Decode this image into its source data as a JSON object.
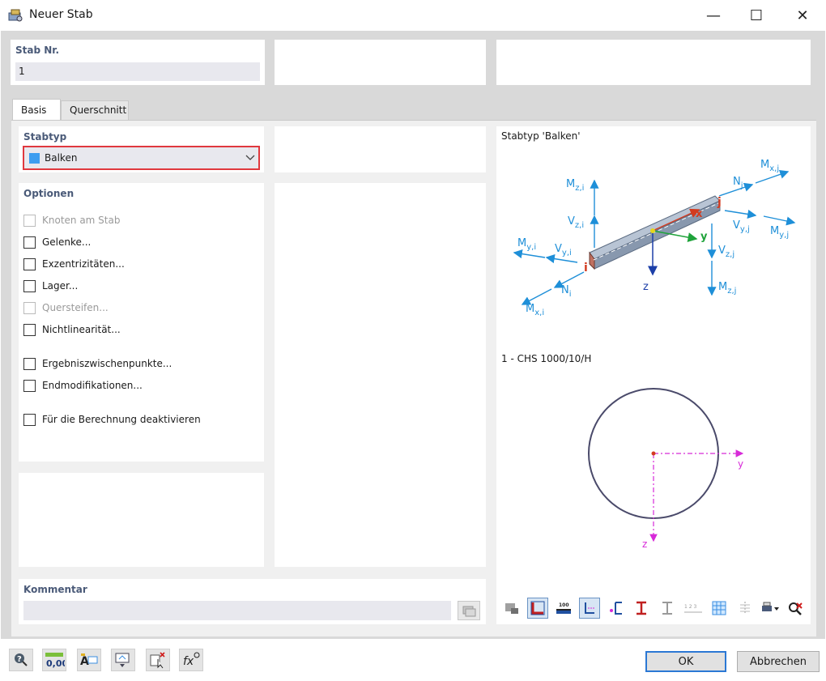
{
  "window": {
    "title": "Neuer Stab",
    "min_glyph": "—",
    "max_glyph": "☐",
    "close_glyph": "✕"
  },
  "stab": {
    "label": "Stab Nr.",
    "value": "1"
  },
  "tabs": [
    {
      "label": "Basis"
    },
    {
      "label": "Querschnitt"
    }
  ],
  "stabtyp": {
    "label": "Stabtyp",
    "value": "Balken",
    "color": "#3d9df0"
  },
  "optionen": {
    "label": "Optionen",
    "items": [
      {
        "label": "Knoten am Stab",
        "enabled": false
      },
      {
        "label": "Gelenke...",
        "enabled": true
      },
      {
        "label": "Exzentrizitäten...",
        "enabled": true
      },
      {
        "label": "Lager...",
        "enabled": true
      },
      {
        "label": "Quersteifen...",
        "enabled": false
      },
      {
        "label": "Nichtlinearität...",
        "enabled": true
      },
      {
        "label": "Ergebniszwischenpunkte...",
        "enabled": true
      },
      {
        "label": "Endmodifikationen...",
        "enabled": true
      },
      {
        "label": "Für die Berechnung deaktivieren",
        "enabled": true
      }
    ]
  },
  "preview": {
    "member_title": "Stabtyp 'Balken'",
    "section_title": "1 - CHS 1000/10/H",
    "labels": {
      "m": "M",
      "v": "V",
      "n": "N",
      "sub_zi": "z,i",
      "sub_yi": "y,i",
      "sub_xi": "x,i",
      "sub_zj": "z,j",
      "sub_yj": "y,j",
      "sub_xj": "x,j",
      "sub_i": "i",
      "sub_j": "j",
      "node_i": "i",
      "node_j": "j",
      "axis_x": "x",
      "axis_y": "y",
      "axis_z": "z"
    },
    "colors": {
      "arrow": "#1e8fd8",
      "axis_x": "#d33b1f",
      "axis_y": "#1fa33b",
      "axis_z": "#1c3fa8",
      "section_axes": "#d72ad8"
    },
    "toolbar_labels": {
      "numbers": "1 2 3",
      "dim": "100"
    }
  },
  "kommentar": {
    "label": "Kommentar",
    "value": ""
  },
  "bottom_tools": [
    {
      "icon": "help-icon"
    },
    {
      "icon": "units-icon",
      "label": "0,00"
    },
    {
      "icon": "text-icon"
    },
    {
      "icon": "view-icon"
    },
    {
      "icon": "select-icon"
    },
    {
      "icon": "formula-icon",
      "label": "fx"
    }
  ],
  "buttons": {
    "ok": "OK",
    "cancel": "Abbrechen"
  }
}
